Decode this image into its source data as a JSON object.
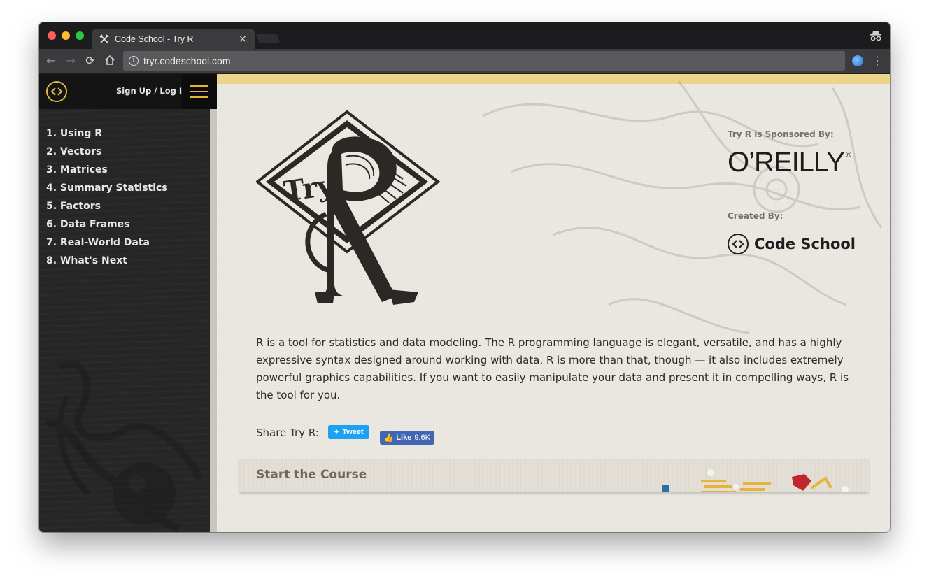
{
  "browser": {
    "tab_title": "Code School - Try R",
    "url": "tryr.codeschool.com",
    "colors": {
      "close": "#fe5f57",
      "minimize": "#febc2e",
      "maximize": "#28c840"
    }
  },
  "sidebar": {
    "auth_link": "Sign Up / Log In",
    "items": [
      "1. Using R",
      "2. Vectors",
      "3. Matrices",
      "4. Summary Statistics",
      "5. Factors",
      "6. Data Frames",
      "7. Real-World Data",
      "8. What's Next"
    ]
  },
  "main": {
    "sponsor_label": "Try R is Sponsored By:",
    "sponsor_name": "O’REILLY",
    "sponsor_reg": "®",
    "creator_label": "Created By:",
    "creator_name": "Code School",
    "intro": "R is a tool for statistics and data modeling. The R programming language is elegant, versatile, and has a highly expressive syntax designed around working with data. R is more than that, though — it also includes extremely powerful graphics capabilities. If you want to easily manipulate your data and present it in compelling ways, R is the tool for you.",
    "share_label": "Share Try R:",
    "tweet_label": "Tweet",
    "like_label": "Like",
    "like_count": "9.6K",
    "start_course": "Start the Course",
    "accent": "#e6b43a"
  }
}
